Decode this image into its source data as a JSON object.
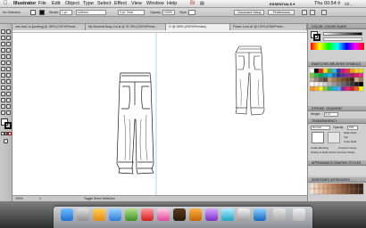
{
  "menubar": {
    "apple": "",
    "app_name": "Illustrator",
    "items": [
      "File",
      "Edit",
      "Object",
      "Type",
      "Select",
      "Effect",
      "View",
      "Window",
      "Help"
    ],
    "workspace": "ESSENTIALS ▾",
    "clock": "Thu 00:54",
    "user": "Cli..."
  },
  "controlbar": {
    "selection_label": "No Selection",
    "stroke_label": "Stroke:",
    "stroke_value": "1 pt",
    "uniform": "Uniform",
    "brush": "3 pt. Oval",
    "opacity_label": "Opacity:",
    "opacity_value": "100%",
    "style_label": "Style:",
    "doc_setup": "Document Setup",
    "preferences": "Preferences"
  },
  "tabs": [
    {
      "label": "new shot 1a [working] @ 150% (CMYK/Previe...",
      "active": false
    },
    {
      "label": "My Students Body Cut.ai @ 76.75% (CMYK/Previe...",
      "active": false
    },
    {
      "label": "1* @ 150% (CMYK/Preview)",
      "active": true
    },
    {
      "label": "Flower 4.eol.ai* @ 100% (RGB/Previe...",
      "active": false
    }
  ],
  "status": {
    "zoom": "150%",
    "page": "1",
    "tool": "Toggle Direct Selection"
  },
  "panels": {
    "color": {
      "title": "COLOR",
      "tab2": "COLOR GUIDE"
    },
    "swatches": {
      "title": "SWATCHES",
      "tab2": "BRUSHES",
      "tab3": "SYMBOLS"
    },
    "stroke": {
      "title": "STROKE",
      "tab2": "GRADIENT",
      "weight_label": "Weight:",
      "weight_value": "1 pt"
    },
    "transparency": {
      "title": "TRANSPARENCY",
      "mode": "Normal",
      "opacity_label": "Opacity:",
      "opacity_value": "100"
    },
    "checkboxes": [
      "Make Mask",
      "Clip",
      "Invert Mask"
    ],
    "options": [
      "Isolate Blending",
      "Knockout Group",
      "Opacity & Mask Define Knockout Shape"
    ],
    "appearance": {
      "title": "APPEARANCE",
      "tab2": "GRAPHIC STYLES"
    },
    "layers": {
      "title": "SKINTONES",
      "tab2": "ARTBOARDS"
    }
  },
  "colors": {
    "accent": "#2b5fd9",
    "guide": "#5ec8e6",
    "artwork_stroke": "#1a1a1a"
  }
}
